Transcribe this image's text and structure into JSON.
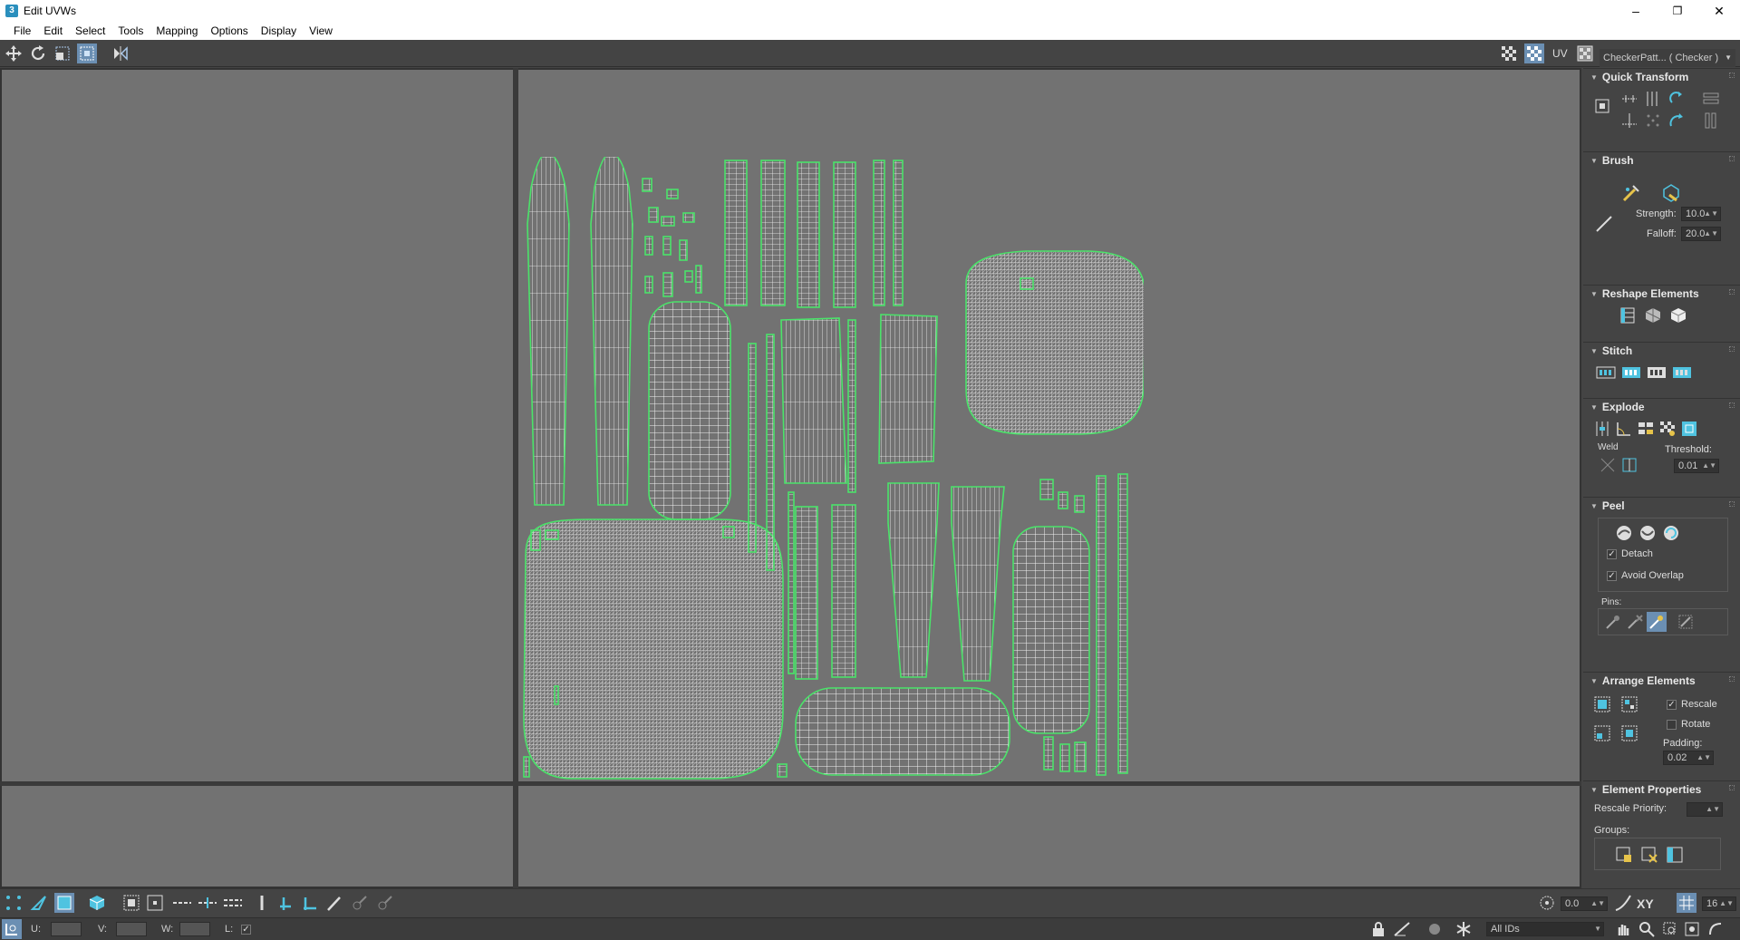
{
  "window": {
    "title": "Edit UVWs",
    "controls": {
      "minimize": "–",
      "restore": "❐",
      "close": "✕"
    }
  },
  "menu": [
    "File",
    "Edit",
    "Select",
    "Tools",
    "Mapping",
    "Options",
    "Display",
    "View"
  ],
  "toolbar": {
    "uv_label": "UV",
    "map_dropdown": "CheckerPatt... ( Checker )"
  },
  "panel": {
    "quick_transform": {
      "title": "Quick Transform"
    },
    "brush": {
      "title": "Brush",
      "strength_label": "Strength:",
      "strength_value": "10.0",
      "falloff_label": "Falloff:",
      "falloff_value": "20.0"
    },
    "reshape": {
      "title": "Reshape Elements"
    },
    "stitch": {
      "title": "Stitch"
    },
    "explode": {
      "title": "Explode",
      "weld_label": "Weld",
      "threshold_label": "Threshold:",
      "threshold_value": "0.01"
    },
    "peel": {
      "title": "Peel",
      "detach_label": "Detach",
      "detach_checked": true,
      "avoid_overlap_label": "Avoid Overlap",
      "avoid_overlap_checked": true,
      "pins_label": "Pins:"
    },
    "arrange": {
      "title": "Arrange Elements",
      "rescale_label": "Rescale",
      "rescale_checked": true,
      "rotate_label": "Rotate",
      "rotate_checked": false,
      "padding_label": "Padding:",
      "padding_value": "0.02"
    },
    "element_props": {
      "title": "Element Properties",
      "rescale_priority_label": "Rescale Priority:",
      "groups_label": "Groups:"
    }
  },
  "bottom_toolbar": {
    "angle_value": "0.0",
    "xy_label": "XY",
    "grid_value": "16"
  },
  "status": {
    "u_label": "U:",
    "v_label": "V:",
    "w_label": "W:",
    "l_label": "L:",
    "ids_dropdown": "All IDs"
  },
  "colors": {
    "uv_edge": "#4be36a",
    "uv_wire": "#ffffff",
    "viewport_bg": "#727272",
    "panel_bg": "#444444",
    "active_button": "#6b8fb3"
  }
}
